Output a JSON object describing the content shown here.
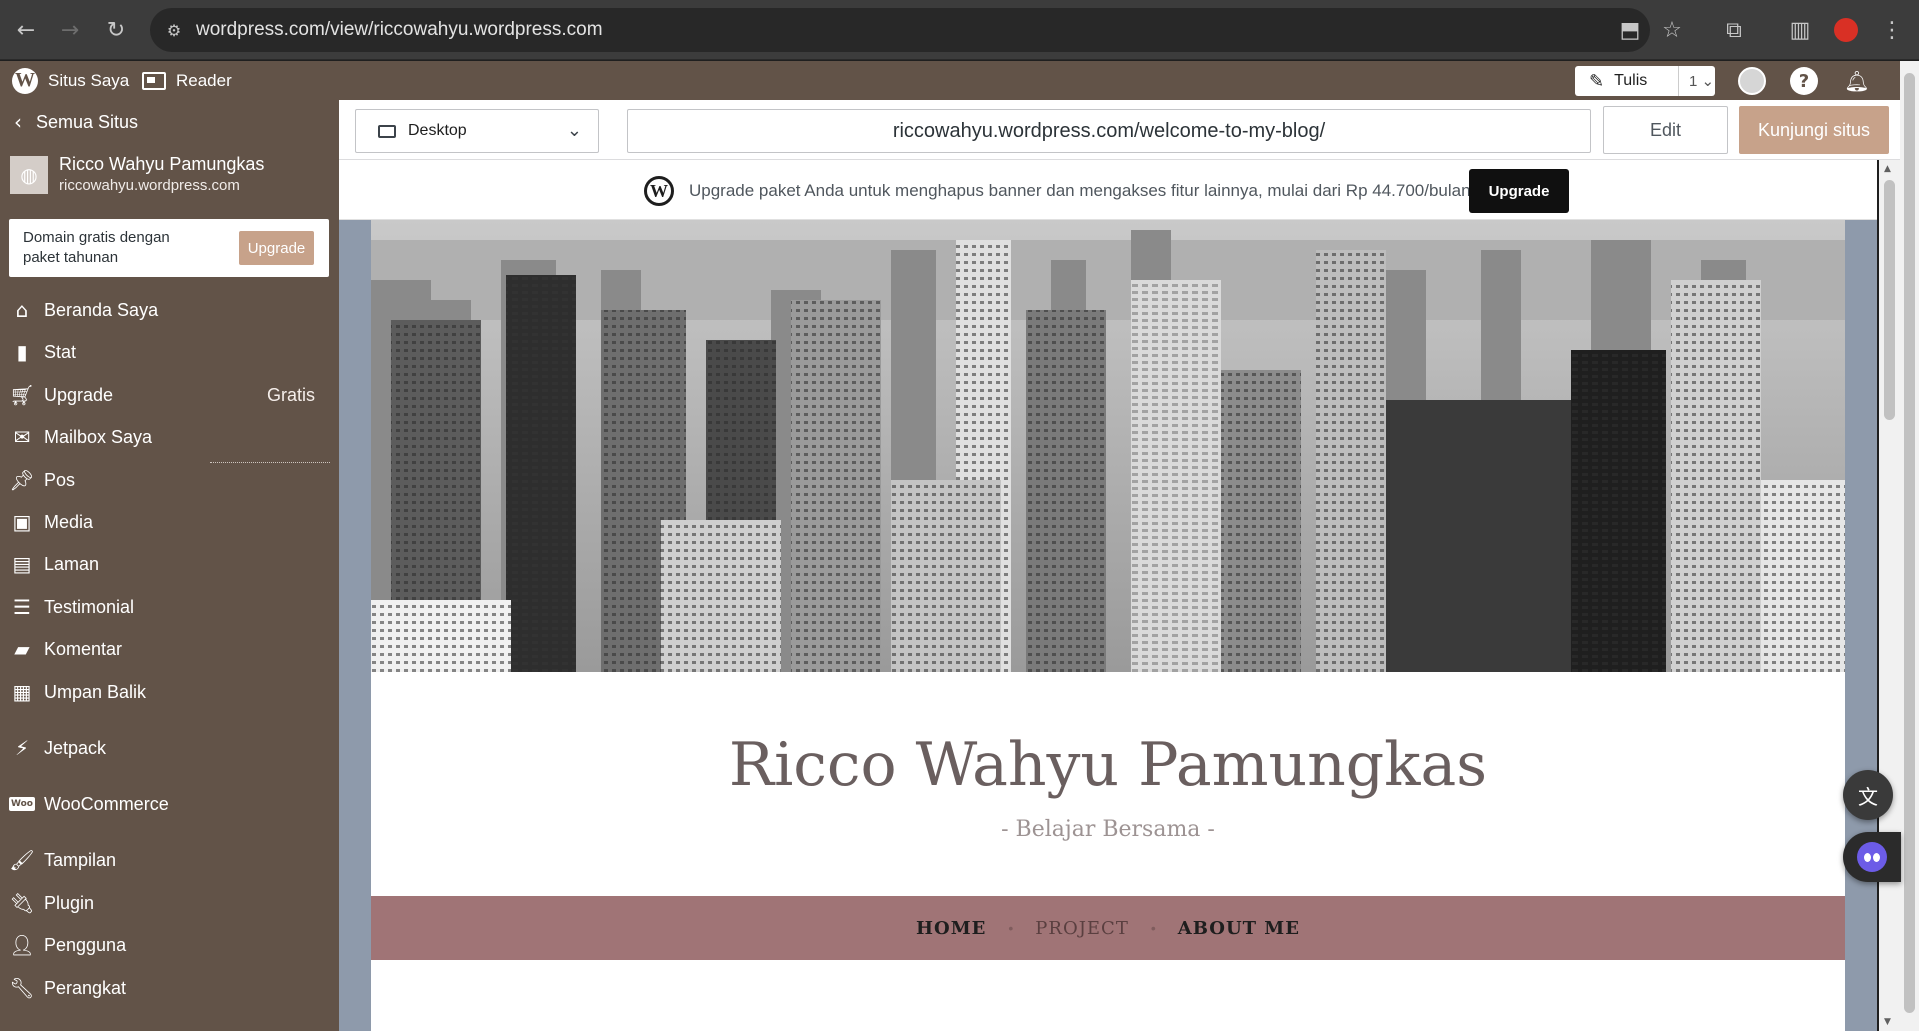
{
  "browser": {
    "url": "wordpress.com/view/riccowahyu.wordpress.com",
    "back_icon": "arrow-left",
    "forward_icon": "arrow-right",
    "reload_icon": "reload",
    "site_info_icon": "tune",
    "install_icon": "install-app",
    "bookmark_icon": "star",
    "extensions_icon": "puzzle",
    "sidepanel_icon": "side-panel",
    "profile_icon": "avatar",
    "menu_icon": "kebab"
  },
  "admin_bar": {
    "my_site_label": "Situs Saya",
    "reader_label": "Reader",
    "write_label": "Tulis",
    "write_count": "1",
    "accent": "#625348"
  },
  "sidebar": {
    "all_sites_label": "Semua Situs",
    "site_name": "Ricco Wahyu Pamungkas",
    "site_url": "riccowahyu.wordpress.com",
    "promo_text": "Domain gratis dengan paket tahunan",
    "promo_button": "Upgrade",
    "items": [
      {
        "label": "Beranda Saya",
        "icon": "home"
      },
      {
        "label": "Stat",
        "icon": "stats"
      },
      {
        "label": "Upgrade",
        "icon": "cart",
        "badge": "Gratis"
      },
      {
        "label": "Mailbox Saya",
        "icon": "mail"
      },
      {
        "label": "Pos",
        "icon": "pin"
      },
      {
        "label": "Media",
        "icon": "media"
      },
      {
        "label": "Laman",
        "icon": "page"
      },
      {
        "label": "Testimonial",
        "icon": "testimonial"
      },
      {
        "label": "Komentar",
        "icon": "comment"
      },
      {
        "label": "Umpan Balik",
        "icon": "feedback"
      },
      {
        "label": "Jetpack",
        "icon": "jetpack"
      },
      {
        "label": "WooCommerce",
        "icon": "woo"
      },
      {
        "label": "Tampilan",
        "icon": "brush"
      },
      {
        "label": "Plugin",
        "icon": "plug"
      },
      {
        "label": "Pengguna",
        "icon": "user"
      },
      {
        "label": "Perangkat",
        "icon": "wrench"
      }
    ]
  },
  "preview": {
    "device_label": "Desktop",
    "preview_url": "riccowahyu.wordpress.com/welcome-to-my-blog/",
    "edit_label": "Edit",
    "visit_label": "Kunjungi situs",
    "banner_message": "Upgrade paket Anda untuk menghapus banner dan mengakses fitur lainnya, mulai dari Rp 44.700/bulan",
    "banner_button": "Upgrade"
  },
  "site": {
    "title": "Ricco Wahyu Pamungkas",
    "tagline": "- Belajar Bersama -",
    "nav": [
      "HOME",
      "PROJECT",
      "ABOUT ME"
    ],
    "nav_color": "#a07476",
    "hero_image": "black-and-white city skyline"
  }
}
